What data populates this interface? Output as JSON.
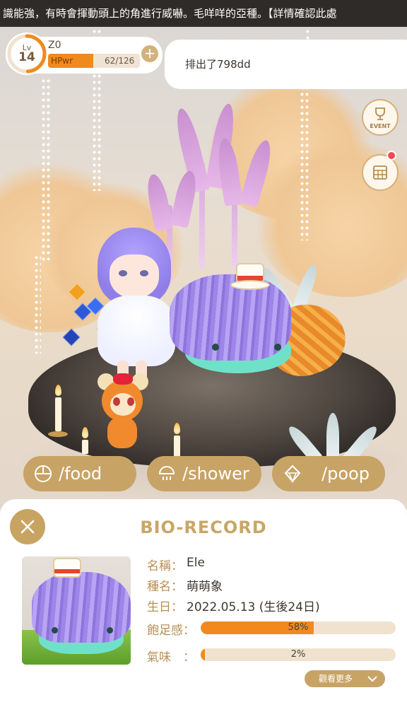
{
  "ticker": {
    "text": "識能強，有時會揮動頭上的角進行威嚇。毛咩咩的亞種。【詳情確認此處"
  },
  "player": {
    "level_label": "Lv",
    "level": "14",
    "name": "Z0",
    "hp_label": "HPwr",
    "hp_value": "62/126",
    "hp_fraction": 0.492
  },
  "speech": {
    "text": "排出了798dd"
  },
  "side_buttons": {
    "event_label": "EVENT",
    "event_icon": "trophy-icon",
    "calendar_icon": "calendar-icon"
  },
  "commands": [
    {
      "label": "/food",
      "icon": "food-bowl-icon"
    },
    {
      "label": "/shower",
      "icon": "shower-icon"
    },
    {
      "label": "/poop",
      "icon": "poop-icon"
    }
  ],
  "panel": {
    "title": "BIO-RECORD",
    "name_label": "名稱：",
    "name_value": "Ele",
    "species_label": "種名：",
    "species_value": "萌萌象",
    "birthday_label": "生日：",
    "birthday_value": "2022.05.13 (生後24日)",
    "satiety_label": "飽足感：",
    "satiety_text": "58%",
    "satiety_value": 58,
    "smell_label": "氣味　：",
    "smell_text": "2%",
    "smell_value": 2,
    "more_label": "觀看更多"
  },
  "colors": {
    "accent_gold": "#c8a463",
    "bar_orange": "#f08a1f",
    "level_ring": "#f08a1f"
  }
}
